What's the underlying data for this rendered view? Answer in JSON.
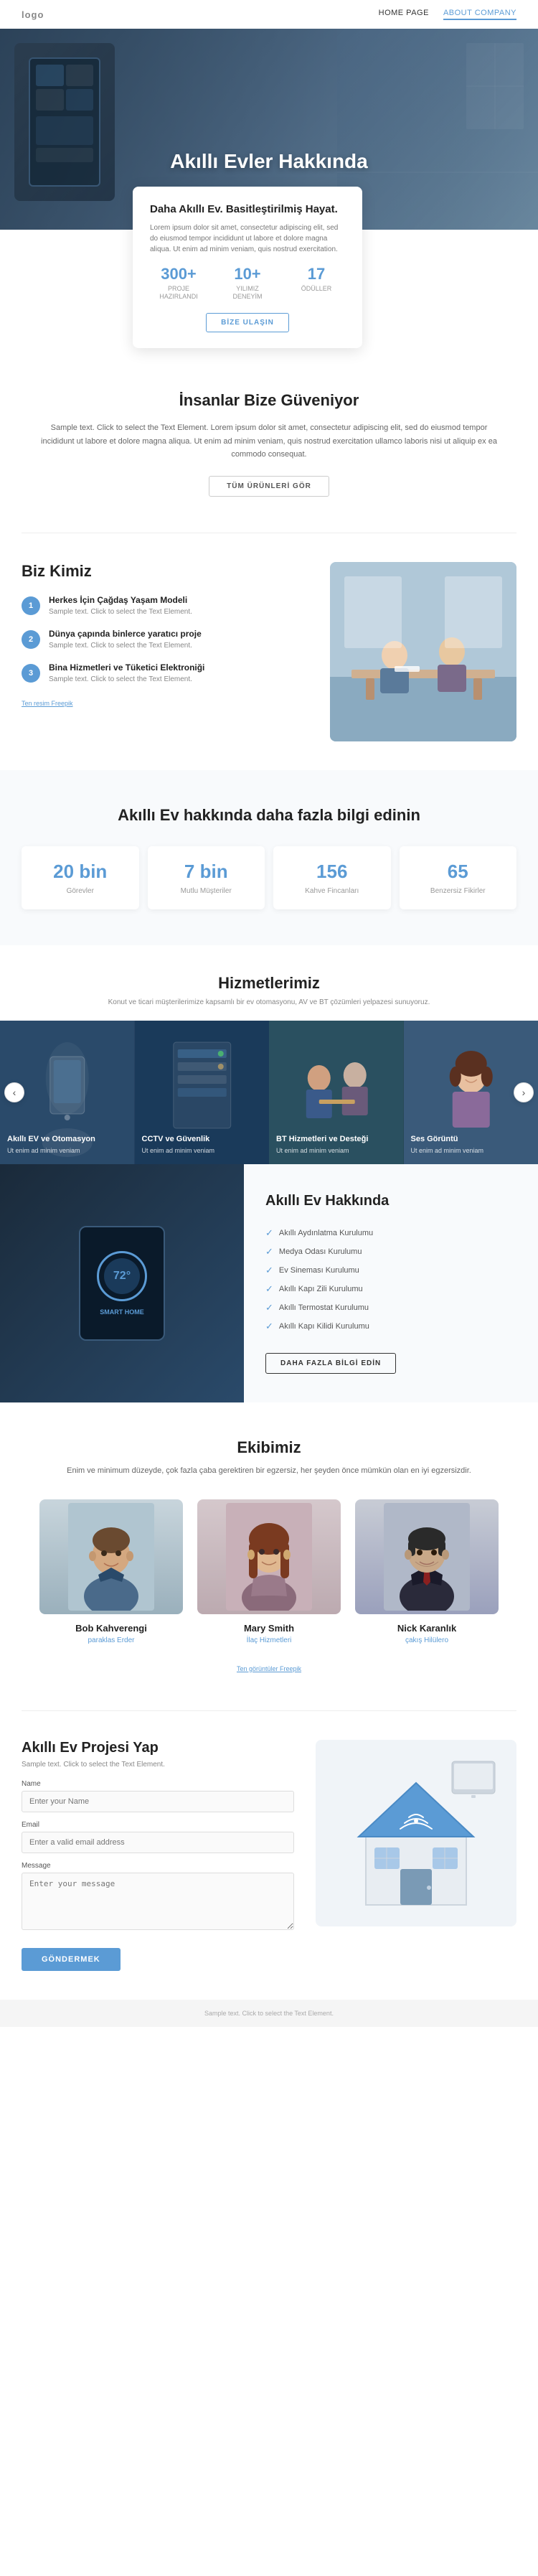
{
  "nav": {
    "logo": "logo",
    "links": [
      {
        "label": "HOME PAGE",
        "active": false
      },
      {
        "label": "ABOUT COMPANY",
        "active": true
      }
    ]
  },
  "hero": {
    "title": "Akıllı Evler Hakkında"
  },
  "info_card": {
    "title": "Daha Akıllı Ev. Basitleştirilmiş Hayat.",
    "text": "Lorem ipsum dolor sit amet, consectetur adipiscing elit, sed do eiusmod tempor incididunt ut labore et dolore magna aliqua. Ut enim ad minim veniam, quis nostrud exercitation.",
    "stats": [
      {
        "number": "300+",
        "label": "PROJE\nHAZIRLANDI"
      },
      {
        "number": "10+",
        "label": "YILIMIZ\nDENEYİM"
      },
      {
        "number": "17",
        "label": "ÖDÜLLER"
      }
    ],
    "cta": "BİZE ULAŞIN"
  },
  "trust_section": {
    "title": "İnsanlar Bize Güveniyor",
    "text": "Sample text. Click to select the Text Element. Lorem ipsum dolor sit amet, consectetur adipiscing elit, sed do eiusmod tempor incididunt ut labore et dolore magna aliqua. Ut enim ad minim veniam, quis nostrud exercitation ullamco laboris nisi ut aliquip ex ea commodo consequat.",
    "cta": "TÜM ÜRÜNLERİ GÖR"
  },
  "biz_kimiz": {
    "title": "Biz Kimiz",
    "items": [
      {
        "number": "1",
        "title": "Herkes İçin Çağdaş Yaşam Modeli",
        "text": "Sample text. Click to select the Text Element."
      },
      {
        "number": "2",
        "title": "Dünya çapında binlerce yaratıcı proje",
        "text": "Sample text. Click to select the Text Element."
      },
      {
        "number": "3",
        "title": "Bina Hizmetleri ve Tüketici Elektroniği",
        "text": "Sample text. Click to select the Text Element."
      }
    ],
    "freepik": "Ten resim Freepik"
  },
  "learn_more": {
    "title": "Akıllı Ev hakkında daha fazla bilgi edinin",
    "stats": [
      {
        "number": "20 bin",
        "label": "Görevler"
      },
      {
        "number": "7 bin",
        "label": "Mutlu Müşteriler"
      },
      {
        "number": "156",
        "label": "Kahve Fincanları"
      },
      {
        "number": "65",
        "label": "Benzersiz Fikirler"
      }
    ]
  },
  "services": {
    "title": "Hizmetlerimiz",
    "subtitle": "Konut ve ticari müşterilerimize kapsamlı bir ev otomasyonu, AV ve BT çözümleri yelpazesi sunuyoruz.",
    "items": [
      {
        "title": "Akıllı EV ve Otomasyon",
        "text": "Ut enim ad minim veniam"
      },
      {
        "title": "CCTV ve Güvenlik",
        "text": "Ut enim ad minim veniam"
      },
      {
        "title": "BT Hizmetleri ve Desteği",
        "text": "Ut enim ad minim veniam"
      },
      {
        "title": "Ses Görüntü",
        "text": "Ut enim ad minim veniam"
      }
    ]
  },
  "smart_home_features": {
    "title": "Akıllı Ev Hakkında",
    "features": [
      "Akıllı Aydınlatma Kurulumu",
      "Medya Odası Kurulumu",
      "Ev Sineması Kurulumu",
      "Akıllı Kapı Zili Kurulumu",
      "Akıllı Termostat Kurulumu",
      "Akıllı Kapı Kilidi Kurulumu"
    ],
    "cta": "DAHA FAZLA BİLGİ EDİN"
  },
  "team": {
    "title": "Ekibimiz",
    "subtitle": "Enim ve minimum düzeyde, çok fazla çaba gerektiren bir egzersiz, her şeyden önce mümkün olan en iyi egzersizdir.",
    "members": [
      {
        "name": "Bob Kahverengi",
        "role": "paraklas Erder"
      },
      {
        "name": "Mary Smith",
        "role": "İlaç Hizmetleri"
      },
      {
        "name": "Nick Karanlık",
        "role": "çakış Hilülero"
      }
    ],
    "freepik": "Ten görüntüler Freepik"
  },
  "contact": {
    "title": "Akıllı Ev Projesi Yap",
    "text": "Sample text. Click to select the Text Element.",
    "form": {
      "name_label": "Name",
      "name_placeholder": "Enter your Name",
      "email_label": "Email",
      "email_placeholder": "Enter a valid email address",
      "message_label": "Message",
      "message_placeholder": "Enter your message",
      "submit": "GÖNDERMEK"
    }
  },
  "footer": {
    "text": "Sample text. Click to select the Text Element."
  }
}
